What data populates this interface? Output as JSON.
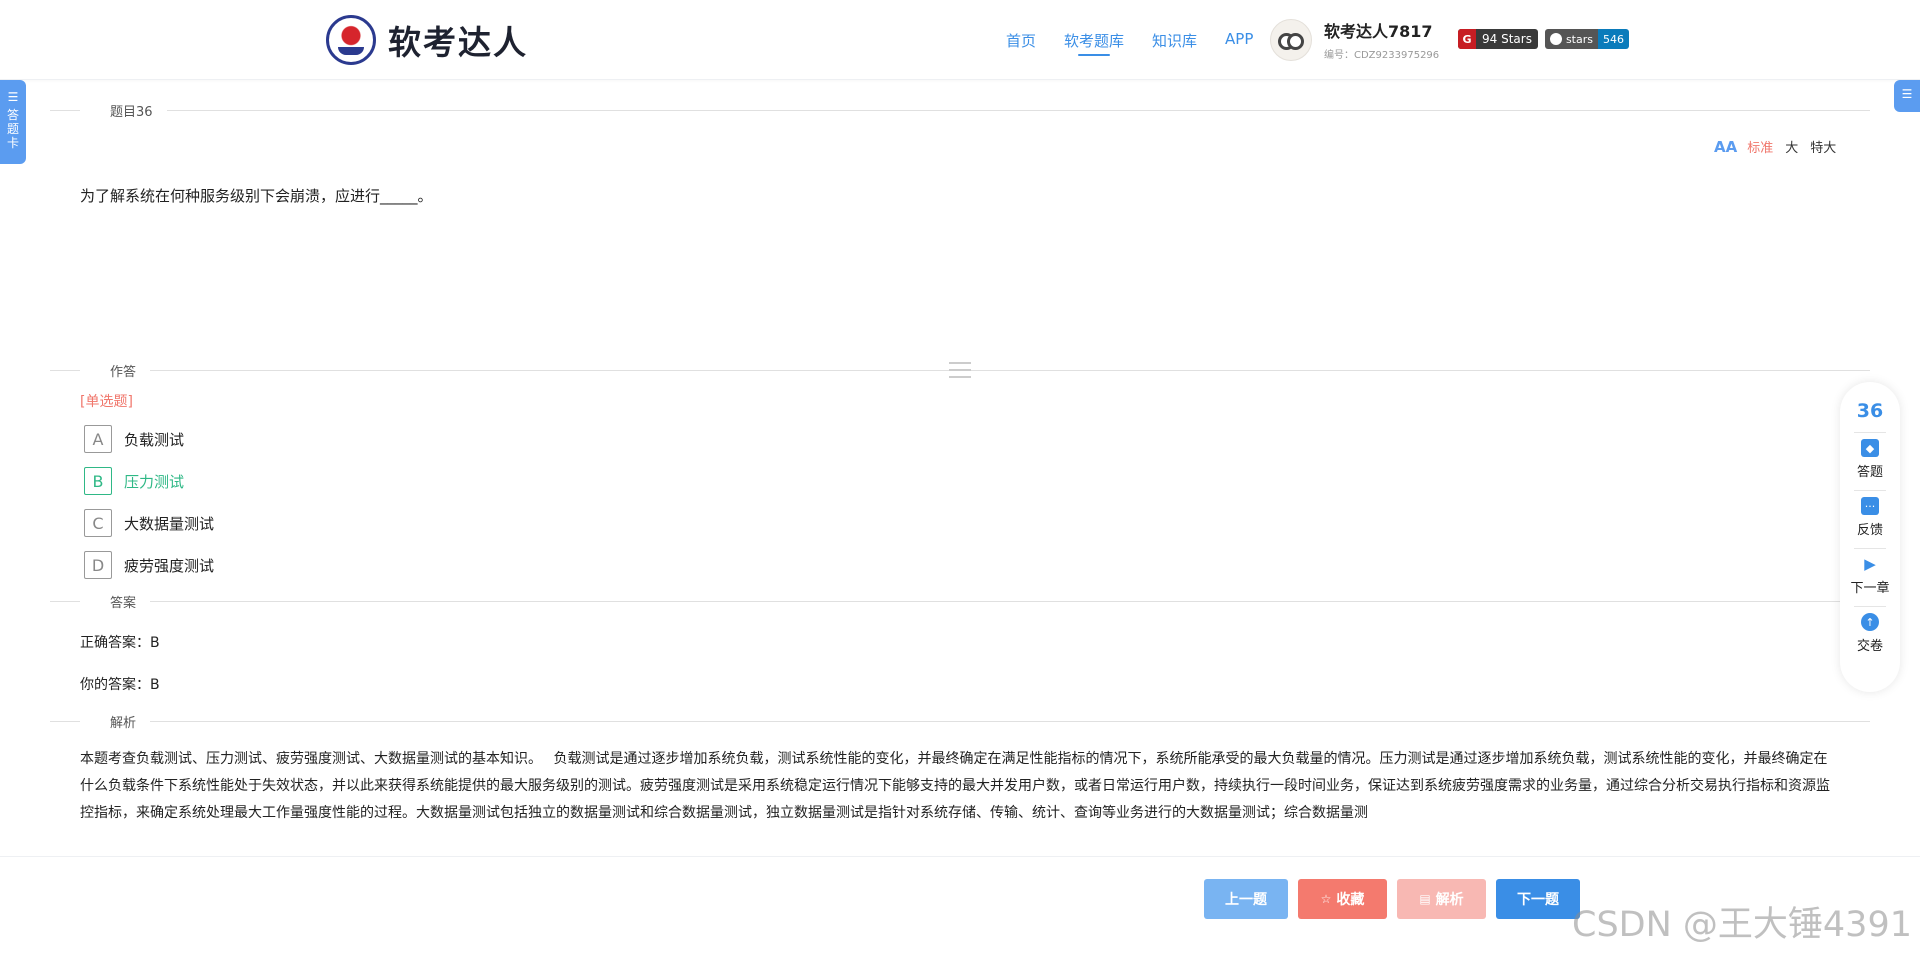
{
  "header": {
    "logo_text": "软考达人",
    "nav": [
      "首页",
      "软考题库",
      "知识库",
      "APP"
    ],
    "active_nav": "软考题库",
    "user_name": "软考达人7817",
    "user_id": "编号：CDZ9233975296",
    "gitee_badge": "94 Stars",
    "github_label": "stars",
    "github_count": "546"
  },
  "left_tab": {
    "chars": [
      "答",
      "题",
      "卡"
    ]
  },
  "question_section": {
    "label": "题目36"
  },
  "font_size": {
    "options": [
      "标准",
      "大",
      "特大"
    ],
    "active": "标准"
  },
  "question": {
    "text": "为了解系统在何种服务级别下会崩溃，应进行_____。"
  },
  "answer_section": {
    "label": "作答"
  },
  "question_type": "[单选题]",
  "options": [
    {
      "letter": "A",
      "text": "负载测试"
    },
    {
      "letter": "B",
      "text": "压力测试"
    },
    {
      "letter": "C",
      "text": "大数据量测试"
    },
    {
      "letter": "D",
      "text": "疲劳强度测试"
    }
  ],
  "selected_option": "B",
  "result_section": {
    "label": "答案"
  },
  "correct_answer": "正确答案：B",
  "your_answer": "你的答案：B",
  "analysis_section": {
    "label": "解析"
  },
  "analysis_text": "本题考查负载测试、压力测试、疲劳强度测试、大数据量测试的基本知识。　 负载测试是通过逐步增加系统负载，测试系统性能的变化，并最终确定在满足性能指标的情况下，系统所能承受的最大负载量的情况。压力测试是通过逐步增加系统负载，测试系统性能的变化，并最终确定在什么负载条件下系统性能处于失效状态，并以此来获得系统能提供的最大服务级别的测试。疲劳强度测试是采用系统稳定运行情况下能够支持的最大并发用户数，或者日常运行用户数，持续执行一段时间业务，保证达到系统疲劳强度需求的业务量，通过综合分析交易执行指标和资源监控指标，来确定系统处理最大工作量强度性能的过程。大数据量测试包括独立的数据量测试和综合数据量测试，独立数据量测试是指针对系统存储、传输、统计、查询等业务进行的大数据量测试；综合数据量测",
  "float_panel": {
    "number": "36",
    "items": [
      "答题",
      "反馈",
      "下一章",
      "交卷"
    ]
  },
  "bottom": {
    "prev": "上一题",
    "fav": "收藏",
    "analysis": "解析",
    "next": "下一题"
  },
  "watermark": "CSDN @王大锤4391",
  "colors": {
    "accent": "#3a8ee6",
    "correct": "#2fb886",
    "danger": "#f0776c"
  }
}
